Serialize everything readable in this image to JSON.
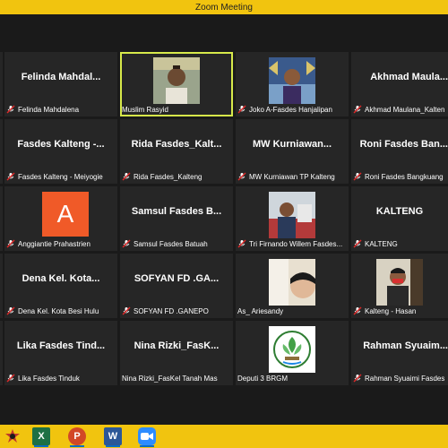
{
  "window": {
    "title": "Zoom Meeting"
  },
  "tiles": {
    "felinda": {
      "center": "Felinda  Mahdal...",
      "label": "Felinda Mahdalena"
    },
    "muslim": {
      "label": "Muslim Rasyid"
    },
    "joko": {
      "label": "Joko A-Fasdes Hanjalipan"
    },
    "akhmad": {
      "center": "Akhmad  Maula...",
      "label": "Akhmad Maulana_Kalten"
    },
    "fasdes_kalteng": {
      "center": "Fasdes Kalteng -...",
      "label": "Fasdes Kalteng - Meiyogie"
    },
    "rida": {
      "center": "Rida Fasdes_Kalt...",
      "label": "Rida Fasdes_Kalteng"
    },
    "mw": {
      "center": "MW  Kurniawan...",
      "label": "MW Kurniawan TP Kalteng"
    },
    "roni": {
      "center": "Roni Fasdes Ban...",
      "label": "Roni Fasdes Bangkuang"
    },
    "anggiantie": {
      "avatar_letter": "A",
      "label": "Anggiantie Prahastrien"
    },
    "samsul": {
      "center": "Samsul Fasdes B...",
      "label": "Samsul Fasdes Batuah"
    },
    "tri": {
      "label": "Tri Firnando Willem Fasdes..."
    },
    "kalteng": {
      "center": "KALTENG",
      "label": "KALTENG"
    },
    "dena": {
      "center": "Dena Kel. Kota...",
      "label": "Dena Kel. Kota Besi Hulu"
    },
    "sofyan": {
      "center": "SOFYAN FD .GA...",
      "label": "SOFYAN FD .GANEPO"
    },
    "as": {
      "label": "As_ Ariesandy"
    },
    "hasan": {
      "label": "Kalteng - Hasan"
    },
    "lika": {
      "center": "Lika Fasdes Tind...",
      "label": "Lika Fasdes Tinduk"
    },
    "nina": {
      "center": "Nina  Rizki_FasK...",
      "label": "Nina Rizki_FasKel Tanah Mas"
    },
    "deputi": {
      "label": "Deputi 3 BRGM"
    },
    "rahman": {
      "center": "Rahman  Syuaim...",
      "label": "Rahman Syuaimi Fasdes"
    }
  },
  "taskbar": {
    "apps": [
      "excel-icon",
      "powerpoint-icon",
      "word-icon",
      "zoom-icon"
    ],
    "excel_letter": "X",
    "powerpoint_letter": "P",
    "word_letter": "W"
  },
  "colors": {
    "titlebar": "#f1c40f",
    "active_border": "#d7e94a",
    "mic_muted": "#e02828",
    "avatar_orange": "#f05a28"
  }
}
